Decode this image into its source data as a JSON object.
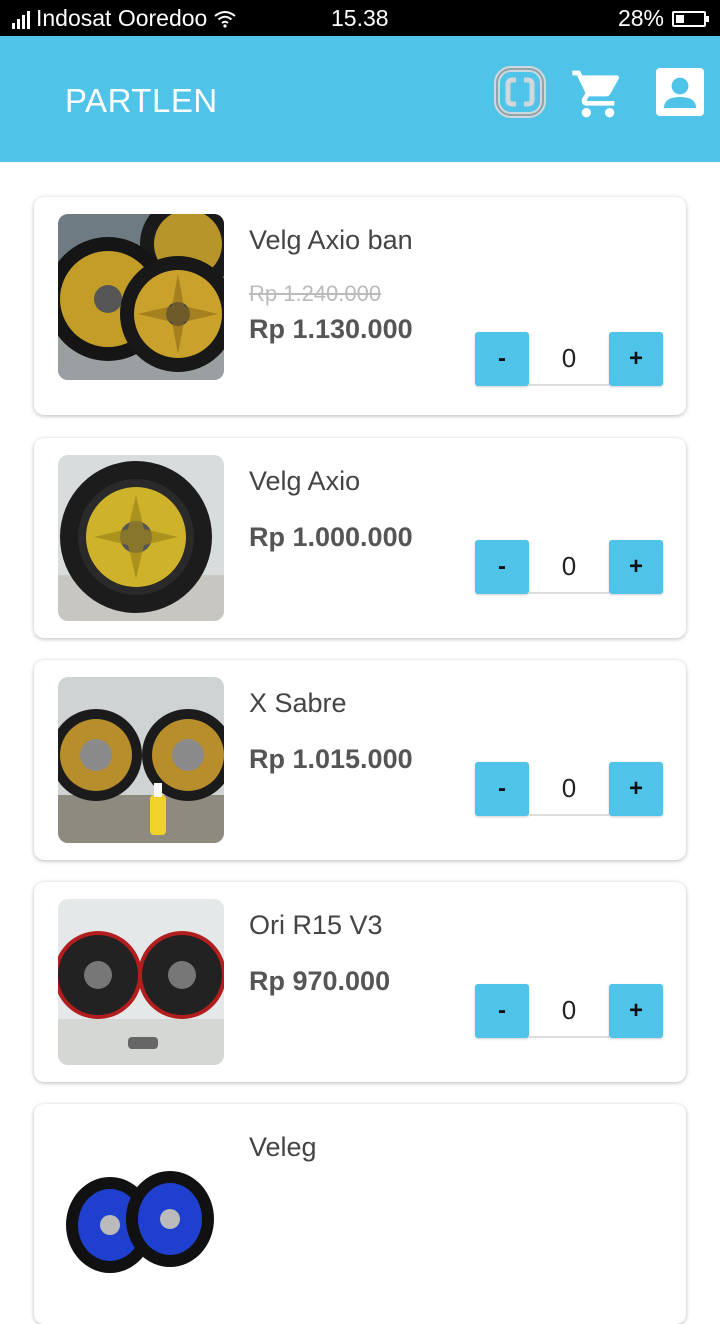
{
  "status_bar": {
    "carrier": "Indosat Ooredoo",
    "time": "15.38",
    "battery": "28%"
  },
  "app_bar": {
    "title": "PARTLEN",
    "icons": [
      "app-logo-icon",
      "cart-icon",
      "account-icon"
    ]
  },
  "colors": {
    "primary": "#4fc3e8",
    "status_bar": "#000000"
  },
  "products": [
    {
      "name": "Velg Axio ban",
      "old_price": "Rp 1.240.000",
      "price": "Rp 1.130.000",
      "qty": "0",
      "minus": "-",
      "plus": "+"
    },
    {
      "name": "Velg Axio",
      "price": "Rp 1.000.000",
      "qty": "0",
      "minus": "-",
      "plus": "+"
    },
    {
      "name": "X Sabre",
      "price": "Rp 1.015.000",
      "qty": "0",
      "minus": "-",
      "plus": "+"
    },
    {
      "name": "Ori R15 V3",
      "price": "Rp 970.000",
      "qty": "0",
      "minus": "-",
      "plus": "+"
    },
    {
      "name": "Veleg"
    }
  ]
}
